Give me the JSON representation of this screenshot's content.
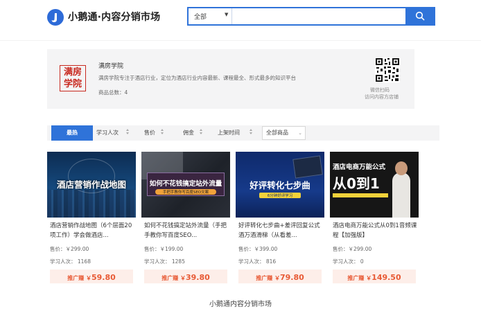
{
  "header": {
    "site_title": "小鹅通·内容分销市场",
    "search": {
      "scope": "全部",
      "placeholder": ""
    }
  },
  "shop": {
    "seal_text": "满房学院",
    "name": "满房学院",
    "description": "满房学院专注于酒店行业，定位为酒店行业内容最新、课程最全、形式最多的知识平台",
    "product_count_label": "商品总数：4",
    "qr_label_1": "微信扫码",
    "qr_label_2": "访问内容方店铺"
  },
  "sort_bar": {
    "items": [
      "最热",
      "学习人次",
      "售价",
      "佣金",
      "上架时间"
    ],
    "active": "最热",
    "filter_select": "全部商品"
  },
  "products": [
    {
      "thumb_title": "酒店营销作战地图",
      "title": "酒店营销作战地图（6个层面20项工作）学会做酒店...",
      "price": "售价：￥299.00",
      "learners": "学习人次：  1168",
      "promo_label": "推广赚 ￥",
      "promo_amount": "59.80"
    },
    {
      "thumb_title": "如何不花钱搞定站外流量",
      "thumb_subtitle": "手把手教你写百度SEO文案",
      "title": "如何不花钱搞定站外流量（手把手教你写百度SEO...",
      "price": "售价：￥199.00",
      "learners": "学习人次：  1285",
      "promo_label": "推广赚 ￥",
      "promo_amount": "39.80"
    },
    {
      "thumb_title": "好评转化七步曲",
      "thumb_subtitle": "6分钟好评学习",
      "title": "好评转化七步曲+差评回复公式酒万酒滑梯（从看差...",
      "price": "售价：￥399.00",
      "learners": "学习人次：  816",
      "promo_label": "推广赚 ￥",
      "promo_amount": "79.80"
    },
    {
      "thumb_title": "酒店电商万能公式",
      "thumb_big": "从0到1",
      "title": "酒店电商万能公式从0到1音频课程【加强版】",
      "price": "售价：￥299.00",
      "learners": "学习人次：  0",
      "promo_label": "推广赚 ￥",
      "promo_amount": "149.50"
    }
  ],
  "footer": {
    "text": "小鹅通内容分销市场"
  },
  "colors": {
    "accent": "#2f73d9",
    "promo_text": "#e85a35",
    "promo_bg": "#fdeee9",
    "seal": "#c8291f"
  },
  "icons": {
    "logo": "goose-logo-icon",
    "search": "search-icon",
    "qr": "qr-code-icon"
  }
}
